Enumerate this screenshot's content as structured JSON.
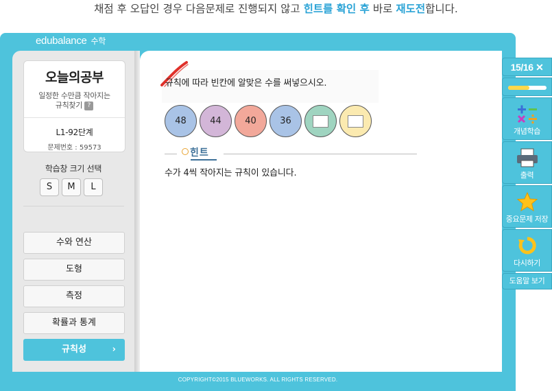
{
  "caption": {
    "part1": "채점 후 오답인 경우 다음문제로 진행되지 않고 ",
    "highlight1": "힌트를 확인 후",
    "part2": " 바로 ",
    "highlight2": "재도전",
    "part3": "합니다."
  },
  "app": {
    "logo": "edubalance",
    "logo_sub": "수학",
    "footer": "COPYRIGHT©2015 BLUEWORKS. ALL RIGHTS RESERVED."
  },
  "sidebar": {
    "today_title": "오늘의공부",
    "today_desc_line1": "일정한 수만큼 작아지는",
    "today_desc_line2": "규칙찾기",
    "help_badge": "?",
    "level": "L1-92단계",
    "problem_number": "문제번호 : 59573",
    "size_label": "학습창 크기 선택",
    "sizes": [
      "S",
      "M",
      "L"
    ],
    "menu": [
      {
        "label": "수와 연산"
      },
      {
        "label": "도형"
      },
      {
        "label": "측정"
      },
      {
        "label": "확률과 통계"
      },
      {
        "label": "규칙성",
        "arrow": "›"
      }
    ]
  },
  "problem": {
    "question": "규칙에 따라 빈칸에 알맞은 수를 써넣으시오.",
    "sequence": [
      "48",
      "44",
      "40",
      "36",
      "",
      ""
    ],
    "circle_colors": [
      "#a9c3e6",
      "#d3b6d8",
      "#f2a89a",
      "#a9c3e6",
      "#9fd4c0",
      "#fbeab0"
    ],
    "hint_title": "힌트",
    "hint_text": "수가 4씩 작아지는 규칙이 있습니다."
  },
  "right_panel": {
    "counter": "15/16 ✕",
    "progress": 0.55,
    "tools": [
      {
        "label": "개념학습",
        "icon": "math-operators-icon"
      },
      {
        "label": "출력",
        "icon": "printer-icon"
      },
      {
        "label": "중요문제 저장",
        "icon": "star-icon"
      },
      {
        "label": "다시하기",
        "icon": "retry-icon"
      }
    ],
    "help": "도움말 보기"
  }
}
